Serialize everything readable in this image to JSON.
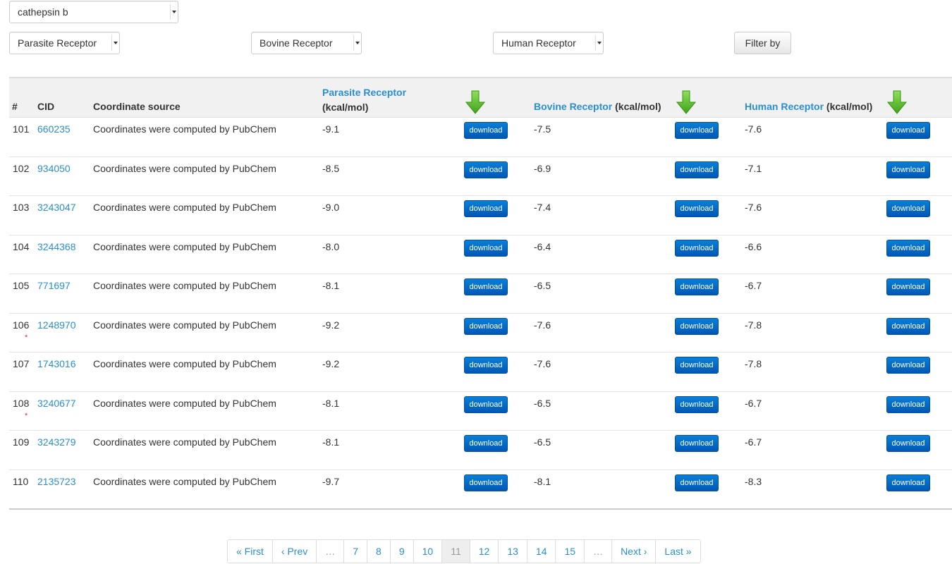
{
  "selects": {
    "compound": "cathepsin b",
    "parasite": "Parasite Receptor",
    "bovine": "Bovine Receptor",
    "human": "Human Receptor"
  },
  "filter_button": "Filter by",
  "table": {
    "headers": {
      "num": "#",
      "cid": "CID",
      "coord": "Coordinate source",
      "parasite_link": "Parasite Receptor",
      "parasite_unit": "(kcal/mol)",
      "bovine_link": "Bovine Receptor",
      "bovine_unit": "(kcal/mol)",
      "human_link": "Human Receptor",
      "human_unit": "(kcal/mol)"
    },
    "download_label": "download",
    "rows": [
      {
        "num": "101",
        "cid": "660235",
        "coord": "Coordinates were computed by PubChem",
        "parasite": "-9.1",
        "bovine": "-7.5",
        "human": "-7.6",
        "star": ""
      },
      {
        "num": "102",
        "cid": "934050",
        "coord": "Coordinates were computed by PubChem",
        "parasite": "-8.5",
        "bovine": "-6.9",
        "human": "-7.1",
        "star": ""
      },
      {
        "num": "103",
        "cid": "3243047",
        "coord": "Coordinates were computed by PubChem",
        "parasite": "-9.0",
        "bovine": "-7.4",
        "human": "-7.6",
        "star": ""
      },
      {
        "num": "104",
        "cid": "3244368",
        "coord": "Coordinates were computed by PubChem",
        "parasite": "-8.0",
        "bovine": "-6.4",
        "human": "-6.6",
        "star": ""
      },
      {
        "num": "105",
        "cid": "771697",
        "coord": "Coordinates were computed by PubChem",
        "parasite": "-8.1",
        "bovine": "-6.5",
        "human": "-6.7",
        "star": ""
      },
      {
        "num": "106",
        "cid": "1248970",
        "coord": "Coordinates were computed by PubChem",
        "parasite": "-9.2",
        "bovine": "-7.6",
        "human": "-7.8",
        "star": "*"
      },
      {
        "num": "107",
        "cid": "1743016",
        "coord": "Coordinates were computed by PubChem",
        "parasite": "-9.2",
        "bovine": "-7.6",
        "human": "-7.8",
        "star": ""
      },
      {
        "num": "108",
        "cid": "3240677",
        "coord": "Coordinates were computed by PubChem",
        "parasite": "-8.1",
        "bovine": "-6.5",
        "human": "-6.7",
        "star": "*"
      },
      {
        "num": "109",
        "cid": "3243279",
        "coord": "Coordinates were computed by PubChem",
        "parasite": "-8.1",
        "bovine": "-6.5",
        "human": "-6.7",
        "star": ""
      },
      {
        "num": "110",
        "cid": "2135723",
        "coord": "Coordinates were computed by PubChem",
        "parasite": "-9.7",
        "bovine": "-8.1",
        "human": "-8.3",
        "star": ""
      }
    ]
  },
  "pagination": {
    "items": [
      {
        "label": "« First",
        "state": "link"
      },
      {
        "label": "‹ Prev",
        "state": "link"
      },
      {
        "label": "…",
        "state": "disabled"
      },
      {
        "label": "7",
        "state": "link"
      },
      {
        "label": "8",
        "state": "link"
      },
      {
        "label": "9",
        "state": "link"
      },
      {
        "label": "10",
        "state": "link"
      },
      {
        "label": "11",
        "state": "active"
      },
      {
        "label": "12",
        "state": "link"
      },
      {
        "label": "13",
        "state": "link"
      },
      {
        "label": "14",
        "state": "link"
      },
      {
        "label": "15",
        "state": "link"
      },
      {
        "label": "…",
        "state": "disabled"
      },
      {
        "label": "Next ›",
        "state": "link"
      },
      {
        "label": "Last »",
        "state": "link"
      }
    ]
  },
  "colors": {
    "link": "#2a8fcf",
    "download_button": "#0a6fd0",
    "arrow_icon": "#5cbf2a",
    "star": "#d9342b"
  },
  "icons": {
    "column_arrow": "green-down-arrow-icon"
  }
}
